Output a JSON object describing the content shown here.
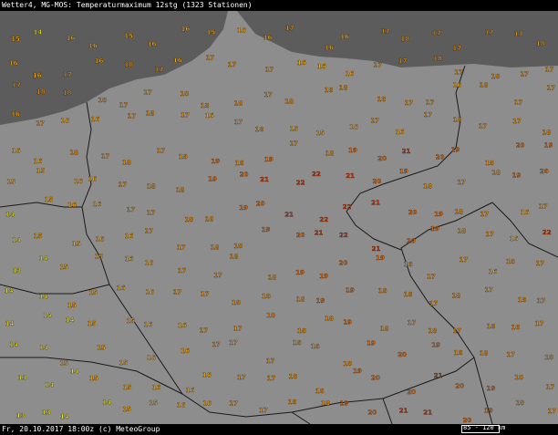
{
  "header": {
    "title": "Wetter4, MG-MOS: Temperaturmaximum 12stg (1323 Stationen)"
  },
  "footer": {
    "datetime_credit": "Fr, 20.10.2017 18:00z (c) MeteoGroup",
    "scale_label": "85 - 120 km"
  },
  "legend_colors": {
    "sea": "#5c5c5c",
    "land": "#8d8d8d",
    "temp_14": "#e8e020",
    "temp_15_16": "#f0a81c",
    "temp_17_18": "#e0901c",
    "temp_19_20": "#d8701c",
    "temp_21_22": "#c84010",
    "borders": "#1a1a1a"
  },
  "stations": [
    {
      "t": "15"
    },
    {
      "t": "14"
    },
    {
      "t": "16"
    },
    {
      "t": "16"
    },
    {
      "t": "15"
    },
    {
      "t": "16"
    },
    {
      "t": "16"
    },
    {
      "t": "15"
    },
    {
      "t": "16"
    },
    {
      "t": "16"
    },
    {
      "t": "17"
    },
    {
      "t": "16"
    },
    {
      "t": "16"
    },
    {
      "t": "17"
    },
    {
      "t": "18"
    },
    {
      "t": "17"
    },
    {
      "t": "17"
    },
    {
      "t": "17"
    },
    {
      "t": "17"
    },
    {
      "t": "18"
    },
    {
      "t": "16"
    },
    {
      "t": "16"
    },
    {
      "t": "17"
    },
    {
      "t": "16"
    },
    {
      "t": "18"
    },
    {
      "t": "17"
    },
    {
      "t": "16"
    },
    {
      "t": "17"
    },
    {
      "t": "17"
    },
    {
      "t": "17"
    },
    {
      "t": "16"
    },
    {
      "t": "16"
    },
    {
      "t": "16"
    },
    {
      "t": "17"
    },
    {
      "t": "17"
    },
    {
      "t": "18"
    },
    {
      "t": "17"
    },
    {
      "t": "18"
    },
    {
      "t": "17"
    },
    {
      "t": "17"
    },
    {
      "t": "17"
    },
    {
      "t": "18"
    },
    {
      "t": "18"
    },
    {
      "t": "18"
    },
    {
      "t": "17"
    },
    {
      "t": "17"
    },
    {
      "t": "18"
    },
    {
      "t": "18"
    },
    {
      "t": "18"
    },
    {
      "t": "17"
    },
    {
      "t": "18"
    },
    {
      "t": "18"
    },
    {
      "t": "18"
    },
    {
      "t": "18"
    },
    {
      "t": "17"
    },
    {
      "t": "17"
    },
    {
      "t": "16"
    },
    {
      "t": "18"
    },
    {
      "t": "17"
    },
    {
      "t": "17"
    },
    {
      "t": "16"
    },
    {
      "t": "17"
    },
    {
      "t": "16"
    },
    {
      "t": "16"
    },
    {
      "t": "17"
    },
    {
      "t": "18"
    },
    {
      "t": "17"
    },
    {
      "t": "16"
    },
    {
      "t": "17"
    },
    {
      "t": "18"
    },
    {
      "t": "15"
    },
    {
      "t": "15"
    },
    {
      "t": "16"
    },
    {
      "t": "17"
    },
    {
      "t": "16"
    },
    {
      "t": "17"
    },
    {
      "t": "18"
    },
    {
      "t": "17"
    },
    {
      "t": "17"
    },
    {
      "t": "18"
    },
    {
      "t": "16"
    },
    {
      "t": "16"
    },
    {
      "t": "18"
    },
    {
      "t": "17"
    },
    {
      "t": "18"
    },
    {
      "t": "17"
    },
    {
      "t": "18"
    },
    {
      "t": "19"
    },
    {
      "t": "18"
    },
    {
      "t": "19"
    },
    {
      "t": "17"
    },
    {
      "t": "18"
    },
    {
      "t": "19"
    },
    {
      "t": "20"
    },
    {
      "t": "21"
    },
    {
      "t": "20"
    },
    {
      "t": "19"
    },
    {
      "t": "18"
    },
    {
      "t": "20"
    },
    {
      "t": "19"
    },
    {
      "t": "15"
    },
    {
      "t": "15"
    },
    {
      "t": "16"
    },
    {
      "t": "16"
    },
    {
      "t": "17"
    },
    {
      "t": "18"
    },
    {
      "t": "18"
    },
    {
      "t": "19"
    },
    {
      "t": "20"
    },
    {
      "t": "21"
    },
    {
      "t": "22"
    },
    {
      "t": "22"
    },
    {
      "t": "21"
    },
    {
      "t": "20"
    },
    {
      "t": "19"
    },
    {
      "t": "18"
    },
    {
      "t": "17"
    },
    {
      "t": "18"
    },
    {
      "t": "19"
    },
    {
      "t": "20"
    },
    {
      "t": "14"
    },
    {
      "t": "15"
    },
    {
      "t": "16"
    },
    {
      "t": "16"
    },
    {
      "t": "17"
    },
    {
      "t": "17"
    },
    {
      "t": "18"
    },
    {
      "t": "18"
    },
    {
      "t": "19"
    },
    {
      "t": "20"
    },
    {
      "t": "21"
    },
    {
      "t": "22"
    },
    {
      "t": "22"
    },
    {
      "t": "21"
    },
    {
      "t": "20"
    },
    {
      "t": "19"
    },
    {
      "t": "18"
    },
    {
      "t": "17"
    },
    {
      "t": "16"
    },
    {
      "t": "17"
    },
    {
      "t": "14"
    },
    {
      "t": "15"
    },
    {
      "t": "15"
    },
    {
      "t": "16"
    },
    {
      "t": "16"
    },
    {
      "t": "17"
    },
    {
      "t": "17"
    },
    {
      "t": "18"
    },
    {
      "t": "18"
    },
    {
      "t": "19"
    },
    {
      "t": "20"
    },
    {
      "t": "21"
    },
    {
      "t": "22"
    },
    {
      "t": "21"
    },
    {
      "t": "20"
    },
    {
      "t": "19"
    },
    {
      "t": "18"
    },
    {
      "t": "17"
    },
    {
      "t": "16"
    },
    {
      "t": "22"
    },
    {
      "t": "13"
    },
    {
      "t": "14"
    },
    {
      "t": "15"
    },
    {
      "t": "15"
    },
    {
      "t": "16"
    },
    {
      "t": "16"
    },
    {
      "t": "17"
    },
    {
      "t": "17"
    },
    {
      "t": "18"
    },
    {
      "t": "18"
    },
    {
      "t": "19"
    },
    {
      "t": "19"
    },
    {
      "t": "20"
    },
    {
      "t": "19"
    },
    {
      "t": "18"
    },
    {
      "t": "17"
    },
    {
      "t": "17"
    },
    {
      "t": "16"
    },
    {
      "t": "18"
    },
    {
      "t": "17"
    },
    {
      "t": "14"
    },
    {
      "t": "14"
    },
    {
      "t": "15"
    },
    {
      "t": "15"
    },
    {
      "t": "16"
    },
    {
      "t": "16"
    },
    {
      "t": "17"
    },
    {
      "t": "17"
    },
    {
      "t": "18"
    },
    {
      "t": "18"
    },
    {
      "t": "18"
    },
    {
      "t": "19"
    },
    {
      "t": "19"
    },
    {
      "t": "18"
    },
    {
      "t": "18"
    },
    {
      "t": "17"
    },
    {
      "t": "18"
    },
    {
      "t": "17"
    },
    {
      "t": "18"
    },
    {
      "t": "17"
    },
    {
      "t": "14"
    },
    {
      "t": "14"
    },
    {
      "t": "14"
    },
    {
      "t": "15"
    },
    {
      "t": "15"
    },
    {
      "t": "16"
    },
    {
      "t": "16"
    },
    {
      "t": "17"
    },
    {
      "t": "17"
    },
    {
      "t": "18"
    },
    {
      "t": "18"
    },
    {
      "t": "18"
    },
    {
      "t": "19"
    },
    {
      "t": "18"
    },
    {
      "t": "17"
    },
    {
      "t": "18"
    },
    {
      "t": "17"
    },
    {
      "t": "18"
    },
    {
      "t": "18"
    },
    {
      "t": "17"
    },
    {
      "t": "14"
    },
    {
      "t": "14"
    },
    {
      "t": "15"
    },
    {
      "t": "15"
    },
    {
      "t": "15"
    },
    {
      "t": "16"
    },
    {
      "t": "16"
    },
    {
      "t": "17"
    },
    {
      "t": "17"
    },
    {
      "t": "17"
    },
    {
      "t": "18"
    },
    {
      "t": "18"
    },
    {
      "t": "18"
    },
    {
      "t": "19"
    },
    {
      "t": "20"
    },
    {
      "t": "19"
    },
    {
      "t": "18"
    },
    {
      "t": "18"
    },
    {
      "t": "17"
    },
    {
      "t": "18"
    },
    {
      "t": "13"
    },
    {
      "t": "14"
    },
    {
      "t": "14"
    },
    {
      "t": "15"
    },
    {
      "t": "15"
    },
    {
      "t": "16"
    },
    {
      "t": "16"
    },
    {
      "t": "16"
    },
    {
      "t": "17"
    },
    {
      "t": "17"
    },
    {
      "t": "18"
    },
    {
      "t": "18"
    },
    {
      "t": "19"
    },
    {
      "t": "20"
    },
    {
      "t": "20"
    },
    {
      "t": "21"
    },
    {
      "t": "20"
    },
    {
      "t": "19"
    },
    {
      "t": "18"
    },
    {
      "t": "17"
    },
    {
      "t": "13"
    },
    {
      "t": "13"
    },
    {
      "t": "14"
    },
    {
      "t": "14"
    },
    {
      "t": "15"
    },
    {
      "t": "15"
    },
    {
      "t": "16"
    },
    {
      "t": "16"
    },
    {
      "t": "17"
    },
    {
      "t": "17"
    },
    {
      "t": "18"
    },
    {
      "t": "18"
    },
    {
      "t": "19"
    },
    {
      "t": "20"
    },
    {
      "t": "21"
    },
    {
      "t": "21"
    },
    {
      "t": "20"
    },
    {
      "t": "19"
    },
    {
      "t": "18"
    },
    {
      "t": "17"
    }
  ]
}
